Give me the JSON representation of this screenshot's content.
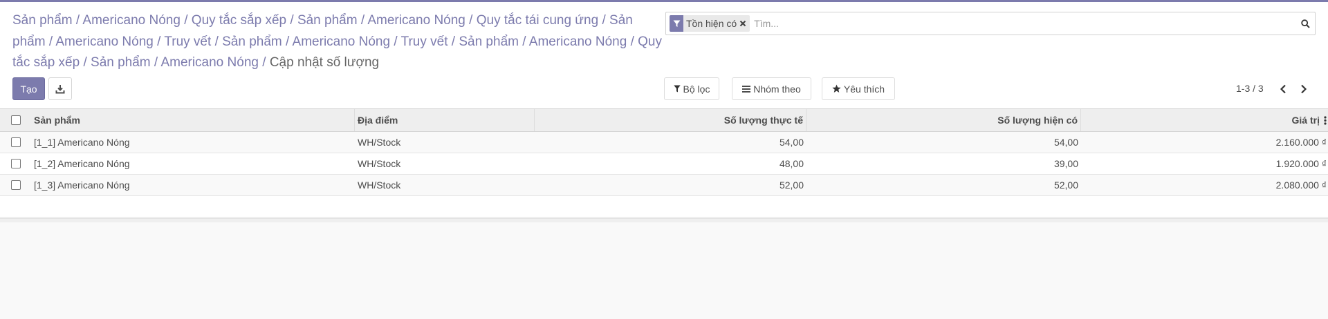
{
  "breadcrumb": {
    "items": [
      "Sản phẩm",
      "Americano Nóng",
      "Quy tắc sắp xếp",
      "Sản phẩm",
      "Americano Nóng",
      "Quy tắc tái cung ứng",
      "Sản phẩm",
      "Americano Nóng",
      "Truy vết",
      "Sản phẩm",
      "Americano Nóng",
      "Truy vết",
      "Sản phẩm",
      "Americano Nóng",
      "Quy tắc sắp xếp",
      "Sản phẩm",
      "Americano Nóng"
    ],
    "current": "Cập nhật số lượng",
    "separator": "/"
  },
  "toolbar": {
    "create_label": "Tạo",
    "download_icon": "download-icon"
  },
  "search": {
    "facet_label": "Tồn hiện có",
    "placeholder": "Tìm...",
    "search_icon": "search-icon"
  },
  "filters": {
    "filter_label": "Bộ lọc",
    "group_label": "Nhóm theo",
    "favorite_label": "Yêu thích"
  },
  "pager": {
    "value": "1-3 / 3"
  },
  "table": {
    "headers": {
      "product": "Sản phẩm",
      "location": "Địa điểm",
      "real_qty": "Số lượng thực tế",
      "avail_qty": "Số lượng hiện có",
      "value": "Giá trị"
    },
    "rows": [
      {
        "product": "[1_1] Americano Nóng",
        "location": "WH/Stock",
        "real_qty": "54,00",
        "avail_qty": "54,00",
        "value": "2.160.000 ₫"
      },
      {
        "product": "[1_2] Americano Nóng",
        "location": "WH/Stock",
        "real_qty": "48,00",
        "avail_qty": "39,00",
        "value": "1.920.000 ₫"
      },
      {
        "product": "[1_3] Americano Nóng",
        "location": "WH/Stock",
        "real_qty": "52,00",
        "avail_qty": "52,00",
        "value": "2.080.000 ₫"
      }
    ]
  },
  "colors": {
    "accent": "#7c7bad",
    "text": "#4c4c4c",
    "background": "#f9f9f9"
  }
}
